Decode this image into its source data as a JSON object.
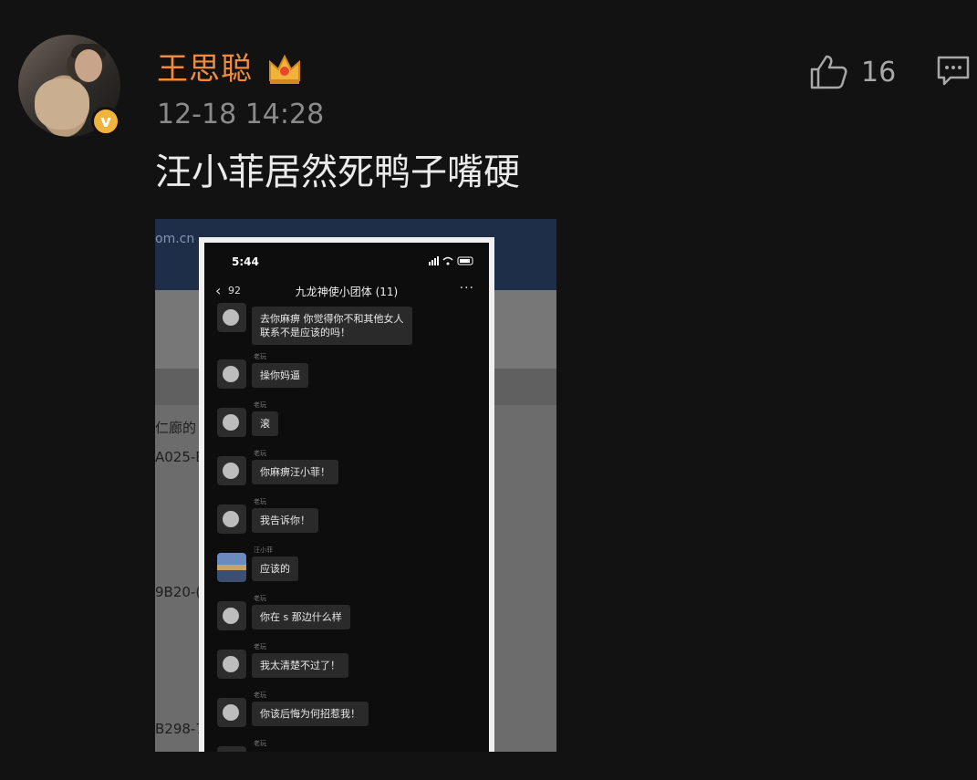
{
  "post": {
    "username": "王思聪",
    "timestamp": "12-18 14:28",
    "text": "汪小菲居然死鸭子嘴硬",
    "like_count": "16",
    "username_color": "#f08a3c",
    "verified_badge": "v",
    "icons": [
      "verified-icon",
      "crown-icon",
      "like-icon",
      "comment-icon"
    ]
  },
  "image": {
    "background": {
      "url_fragment": "om.cn",
      "labels": [
        "仁廊的",
        "A025-E",
        "9B20-(",
        "B298-7"
      ]
    },
    "phone": {
      "status_time": "5:44",
      "back_count": "92",
      "group_title": "九龙神使小团体 (11)",
      "more": "···",
      "messages": [
        {
          "nick": "",
          "text_lines": [
            "去你麻痹 你觉得你不和其他女人",
            "联系不是应该的吗！"
          ]
        },
        {
          "nick": "老玩",
          "text_lines": [
            "操你妈逼"
          ]
        },
        {
          "nick": "老玩",
          "text_lines": [
            "滚"
          ]
        },
        {
          "nick": "老玩",
          "text_lines": [
            "你麻痹汪小菲！"
          ]
        },
        {
          "nick": "老玩",
          "text_lines": [
            "我告诉你！"
          ]
        },
        {
          "nick": "汪小菲",
          "text_lines": [
            "应该的"
          ]
        },
        {
          "nick": "老玩",
          "text_lines": [
            "你在 s 那边什么样"
          ]
        },
        {
          "nick": "老玩",
          "text_lines": [
            "我太清楚不过了！"
          ]
        },
        {
          "nick": "老玩",
          "text_lines": [
            "你该后悔为何招惹我！"
          ]
        },
        {
          "nick": "老玩",
          "text_lines": []
        }
      ]
    }
  }
}
